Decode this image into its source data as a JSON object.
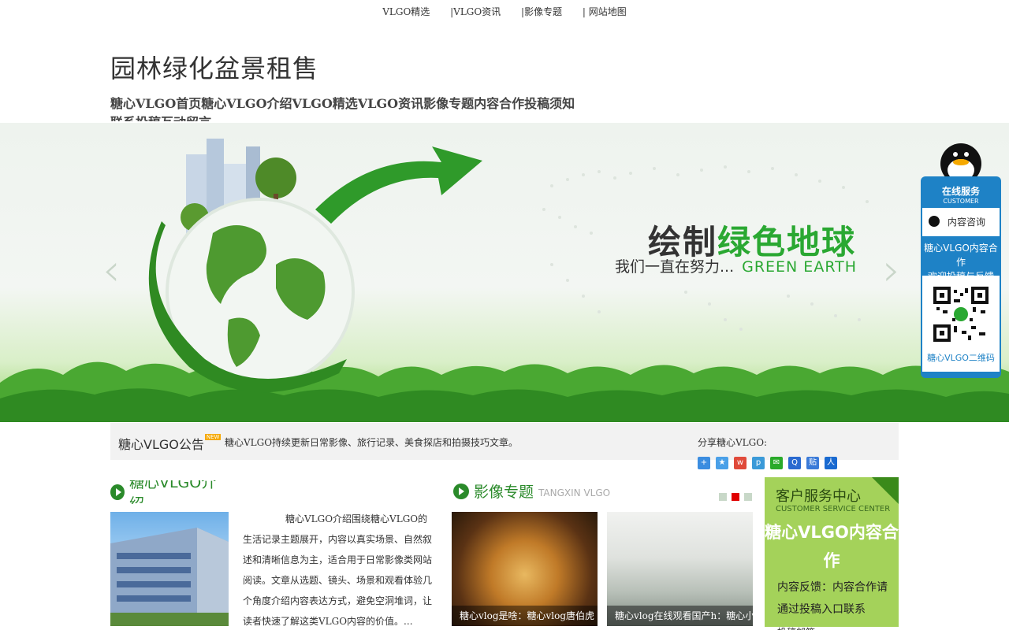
{
  "topnav": [
    "VLGO精选",
    "|VLGO资讯",
    "|影像专题",
    "| 网站地图"
  ],
  "site_title": "园林绿化盆景租售",
  "mainnav_text": "糖心VLGO首页糖心VLGO介绍VLGO精选VLGO资讯影像专题内容合作投稿须知联系投稿互动留言",
  "banner": {
    "title_dark": "绘制",
    "title_green": "绿色地球",
    "subtitle": "我们一直在努力...",
    "subtitle_en": "GREEN EARTH",
    "prev": "‹",
    "next": "›"
  },
  "notice": {
    "title": "糖心VLGO公告",
    "badge": "NEW",
    "text": "糖心VLGO持续更新日常影像、旅行记录、美食探店和拍摄技巧文章。"
  },
  "share": {
    "label": "分享糖心VLGO:"
  },
  "about": {
    "title": "糖心VLGO介绍",
    "text": "糖心VLGO介绍围绕糖心VLGO的生活记录主题展开，内容以真实场景、自然叙述和清晰信息为主，适合用于日常影像类网站阅读。文章从选题、镜头、场景和观看体验几个角度介绍内容表达方式，避免空洞堆词，让读者快速了解这类VLGO内容的价值。..."
  },
  "video": {
    "title": "影像专题",
    "title_en": "TANGXIN VLGO",
    "cards": [
      {
        "caption": "糖心vlog是啥：糖心vlog唐伯虎"
      },
      {
        "caption": "糖心vlog在线观看国产h：糖心小"
      }
    ]
  },
  "service": {
    "title": "客户服务中心",
    "title_en": "CUSTOMER SERVICE CENTER",
    "big": "糖心VLGO内容合作",
    "text": "内容反馈：内容合作请通过投稿入口联系",
    "more": "投稿邮箱"
  },
  "float": {
    "head": "在线服务",
    "head_en": "CUSTOMER",
    "consult": "内容咨询",
    "msg1": "糖心VLGO内容合作",
    "msg2": "欢迎投稿与反馈",
    "qr_label": "糖心VLGO二维码"
  }
}
